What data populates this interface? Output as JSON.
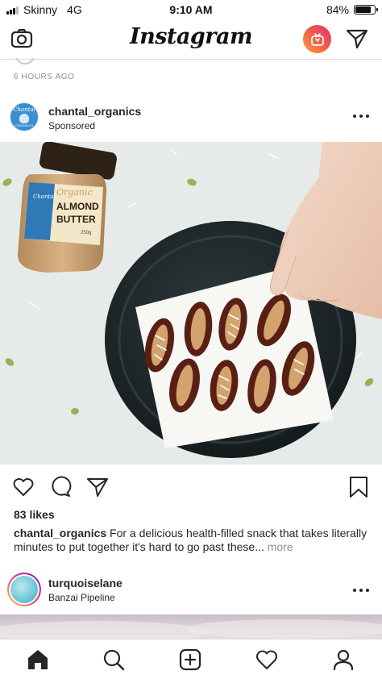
{
  "status_bar": {
    "carrier": "Skinny",
    "network": "4G",
    "time": "9:10 AM",
    "battery_percent": "84%",
    "battery_level": 0.84
  },
  "app": {
    "title": "Instagram"
  },
  "previous_post": {
    "time_ago": "6 HOURS AGO"
  },
  "post": {
    "username": "chantal_organics",
    "subtitle": "Sponsored",
    "likes": "83 likes",
    "caption_user": "chantal_organics",
    "caption_text": "For a delicious health-filled snack that takes literally minutes to put together it's hard to go past these...",
    "caption_more": "more",
    "image": {
      "jar_brand": "Chantal",
      "jar_line1": "Organic",
      "jar_line2": "ALMOND",
      "jar_line3": "BUTTER",
      "jar_weight": "250g"
    }
  },
  "next_post": {
    "username": "turquoiselane",
    "subtitle": "Banzai Pipeline"
  },
  "icons": {
    "camera": "camera-icon",
    "igtv": "igtv-icon",
    "direct": "paper-plane-icon",
    "like": "heart-icon",
    "comment": "comment-icon",
    "share": "paper-plane-icon",
    "save": "bookmark-icon",
    "home": "home-icon",
    "search": "search-icon",
    "new_post": "plus-square-icon",
    "activity": "heart-icon",
    "profile": "person-icon"
  },
  "colors": {
    "text": "#262626",
    "secondary": "#8e8e8e",
    "divider": "#dbdbdb",
    "igtv_gradient_start": "#f9a03f",
    "igtv_gradient_end": "#e0306e",
    "brand_blue": "#3b8fce"
  }
}
